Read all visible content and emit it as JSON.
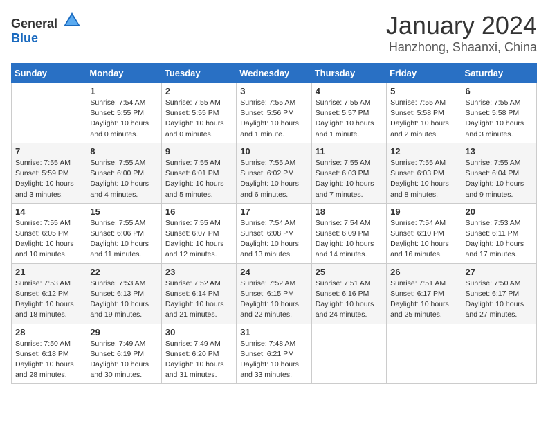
{
  "header": {
    "logo": {
      "text_general": "General",
      "text_blue": "Blue"
    },
    "title": "January 2024",
    "location": "Hanzhong, Shaanxi, China"
  },
  "calendar": {
    "days_of_week": [
      "Sunday",
      "Monday",
      "Tuesday",
      "Wednesday",
      "Thursday",
      "Friday",
      "Saturday"
    ],
    "weeks": [
      [
        {
          "day": "",
          "info": ""
        },
        {
          "day": "1",
          "info": "Sunrise: 7:54 AM\nSunset: 5:55 PM\nDaylight: 10 hours\nand 0 minutes."
        },
        {
          "day": "2",
          "info": "Sunrise: 7:55 AM\nSunset: 5:55 PM\nDaylight: 10 hours\nand 0 minutes."
        },
        {
          "day": "3",
          "info": "Sunrise: 7:55 AM\nSunset: 5:56 PM\nDaylight: 10 hours\nand 1 minute."
        },
        {
          "day": "4",
          "info": "Sunrise: 7:55 AM\nSunset: 5:57 PM\nDaylight: 10 hours\nand 1 minute."
        },
        {
          "day": "5",
          "info": "Sunrise: 7:55 AM\nSunset: 5:58 PM\nDaylight: 10 hours\nand 2 minutes."
        },
        {
          "day": "6",
          "info": "Sunrise: 7:55 AM\nSunset: 5:58 PM\nDaylight: 10 hours\nand 3 minutes."
        }
      ],
      [
        {
          "day": "7",
          "info": "Sunrise: 7:55 AM\nSunset: 5:59 PM\nDaylight: 10 hours\nand 3 minutes."
        },
        {
          "day": "8",
          "info": "Sunrise: 7:55 AM\nSunset: 6:00 PM\nDaylight: 10 hours\nand 4 minutes."
        },
        {
          "day": "9",
          "info": "Sunrise: 7:55 AM\nSunset: 6:01 PM\nDaylight: 10 hours\nand 5 minutes."
        },
        {
          "day": "10",
          "info": "Sunrise: 7:55 AM\nSunset: 6:02 PM\nDaylight: 10 hours\nand 6 minutes."
        },
        {
          "day": "11",
          "info": "Sunrise: 7:55 AM\nSunset: 6:03 PM\nDaylight: 10 hours\nand 7 minutes."
        },
        {
          "day": "12",
          "info": "Sunrise: 7:55 AM\nSunset: 6:03 PM\nDaylight: 10 hours\nand 8 minutes."
        },
        {
          "day": "13",
          "info": "Sunrise: 7:55 AM\nSunset: 6:04 PM\nDaylight: 10 hours\nand 9 minutes."
        }
      ],
      [
        {
          "day": "14",
          "info": "Sunrise: 7:55 AM\nSunset: 6:05 PM\nDaylight: 10 hours\nand 10 minutes."
        },
        {
          "day": "15",
          "info": "Sunrise: 7:55 AM\nSunset: 6:06 PM\nDaylight: 10 hours\nand 11 minutes."
        },
        {
          "day": "16",
          "info": "Sunrise: 7:55 AM\nSunset: 6:07 PM\nDaylight: 10 hours\nand 12 minutes."
        },
        {
          "day": "17",
          "info": "Sunrise: 7:54 AM\nSunset: 6:08 PM\nDaylight: 10 hours\nand 13 minutes."
        },
        {
          "day": "18",
          "info": "Sunrise: 7:54 AM\nSunset: 6:09 PM\nDaylight: 10 hours\nand 14 minutes."
        },
        {
          "day": "19",
          "info": "Sunrise: 7:54 AM\nSunset: 6:10 PM\nDaylight: 10 hours\nand 16 minutes."
        },
        {
          "day": "20",
          "info": "Sunrise: 7:53 AM\nSunset: 6:11 PM\nDaylight: 10 hours\nand 17 minutes."
        }
      ],
      [
        {
          "day": "21",
          "info": "Sunrise: 7:53 AM\nSunset: 6:12 PM\nDaylight: 10 hours\nand 18 minutes."
        },
        {
          "day": "22",
          "info": "Sunrise: 7:53 AM\nSunset: 6:13 PM\nDaylight: 10 hours\nand 19 minutes."
        },
        {
          "day": "23",
          "info": "Sunrise: 7:52 AM\nSunset: 6:14 PM\nDaylight: 10 hours\nand 21 minutes."
        },
        {
          "day": "24",
          "info": "Sunrise: 7:52 AM\nSunset: 6:15 PM\nDaylight: 10 hours\nand 22 minutes."
        },
        {
          "day": "25",
          "info": "Sunrise: 7:51 AM\nSunset: 6:16 PM\nDaylight: 10 hours\nand 24 minutes."
        },
        {
          "day": "26",
          "info": "Sunrise: 7:51 AM\nSunset: 6:17 PM\nDaylight: 10 hours\nand 25 minutes."
        },
        {
          "day": "27",
          "info": "Sunrise: 7:50 AM\nSunset: 6:17 PM\nDaylight: 10 hours\nand 27 minutes."
        }
      ],
      [
        {
          "day": "28",
          "info": "Sunrise: 7:50 AM\nSunset: 6:18 PM\nDaylight: 10 hours\nand 28 minutes."
        },
        {
          "day": "29",
          "info": "Sunrise: 7:49 AM\nSunset: 6:19 PM\nDaylight: 10 hours\nand 30 minutes."
        },
        {
          "day": "30",
          "info": "Sunrise: 7:49 AM\nSunset: 6:20 PM\nDaylight: 10 hours\nand 31 minutes."
        },
        {
          "day": "31",
          "info": "Sunrise: 7:48 AM\nSunset: 6:21 PM\nDaylight: 10 hours\nand 33 minutes."
        },
        {
          "day": "",
          "info": ""
        },
        {
          "day": "",
          "info": ""
        },
        {
          "day": "",
          "info": ""
        }
      ]
    ]
  }
}
